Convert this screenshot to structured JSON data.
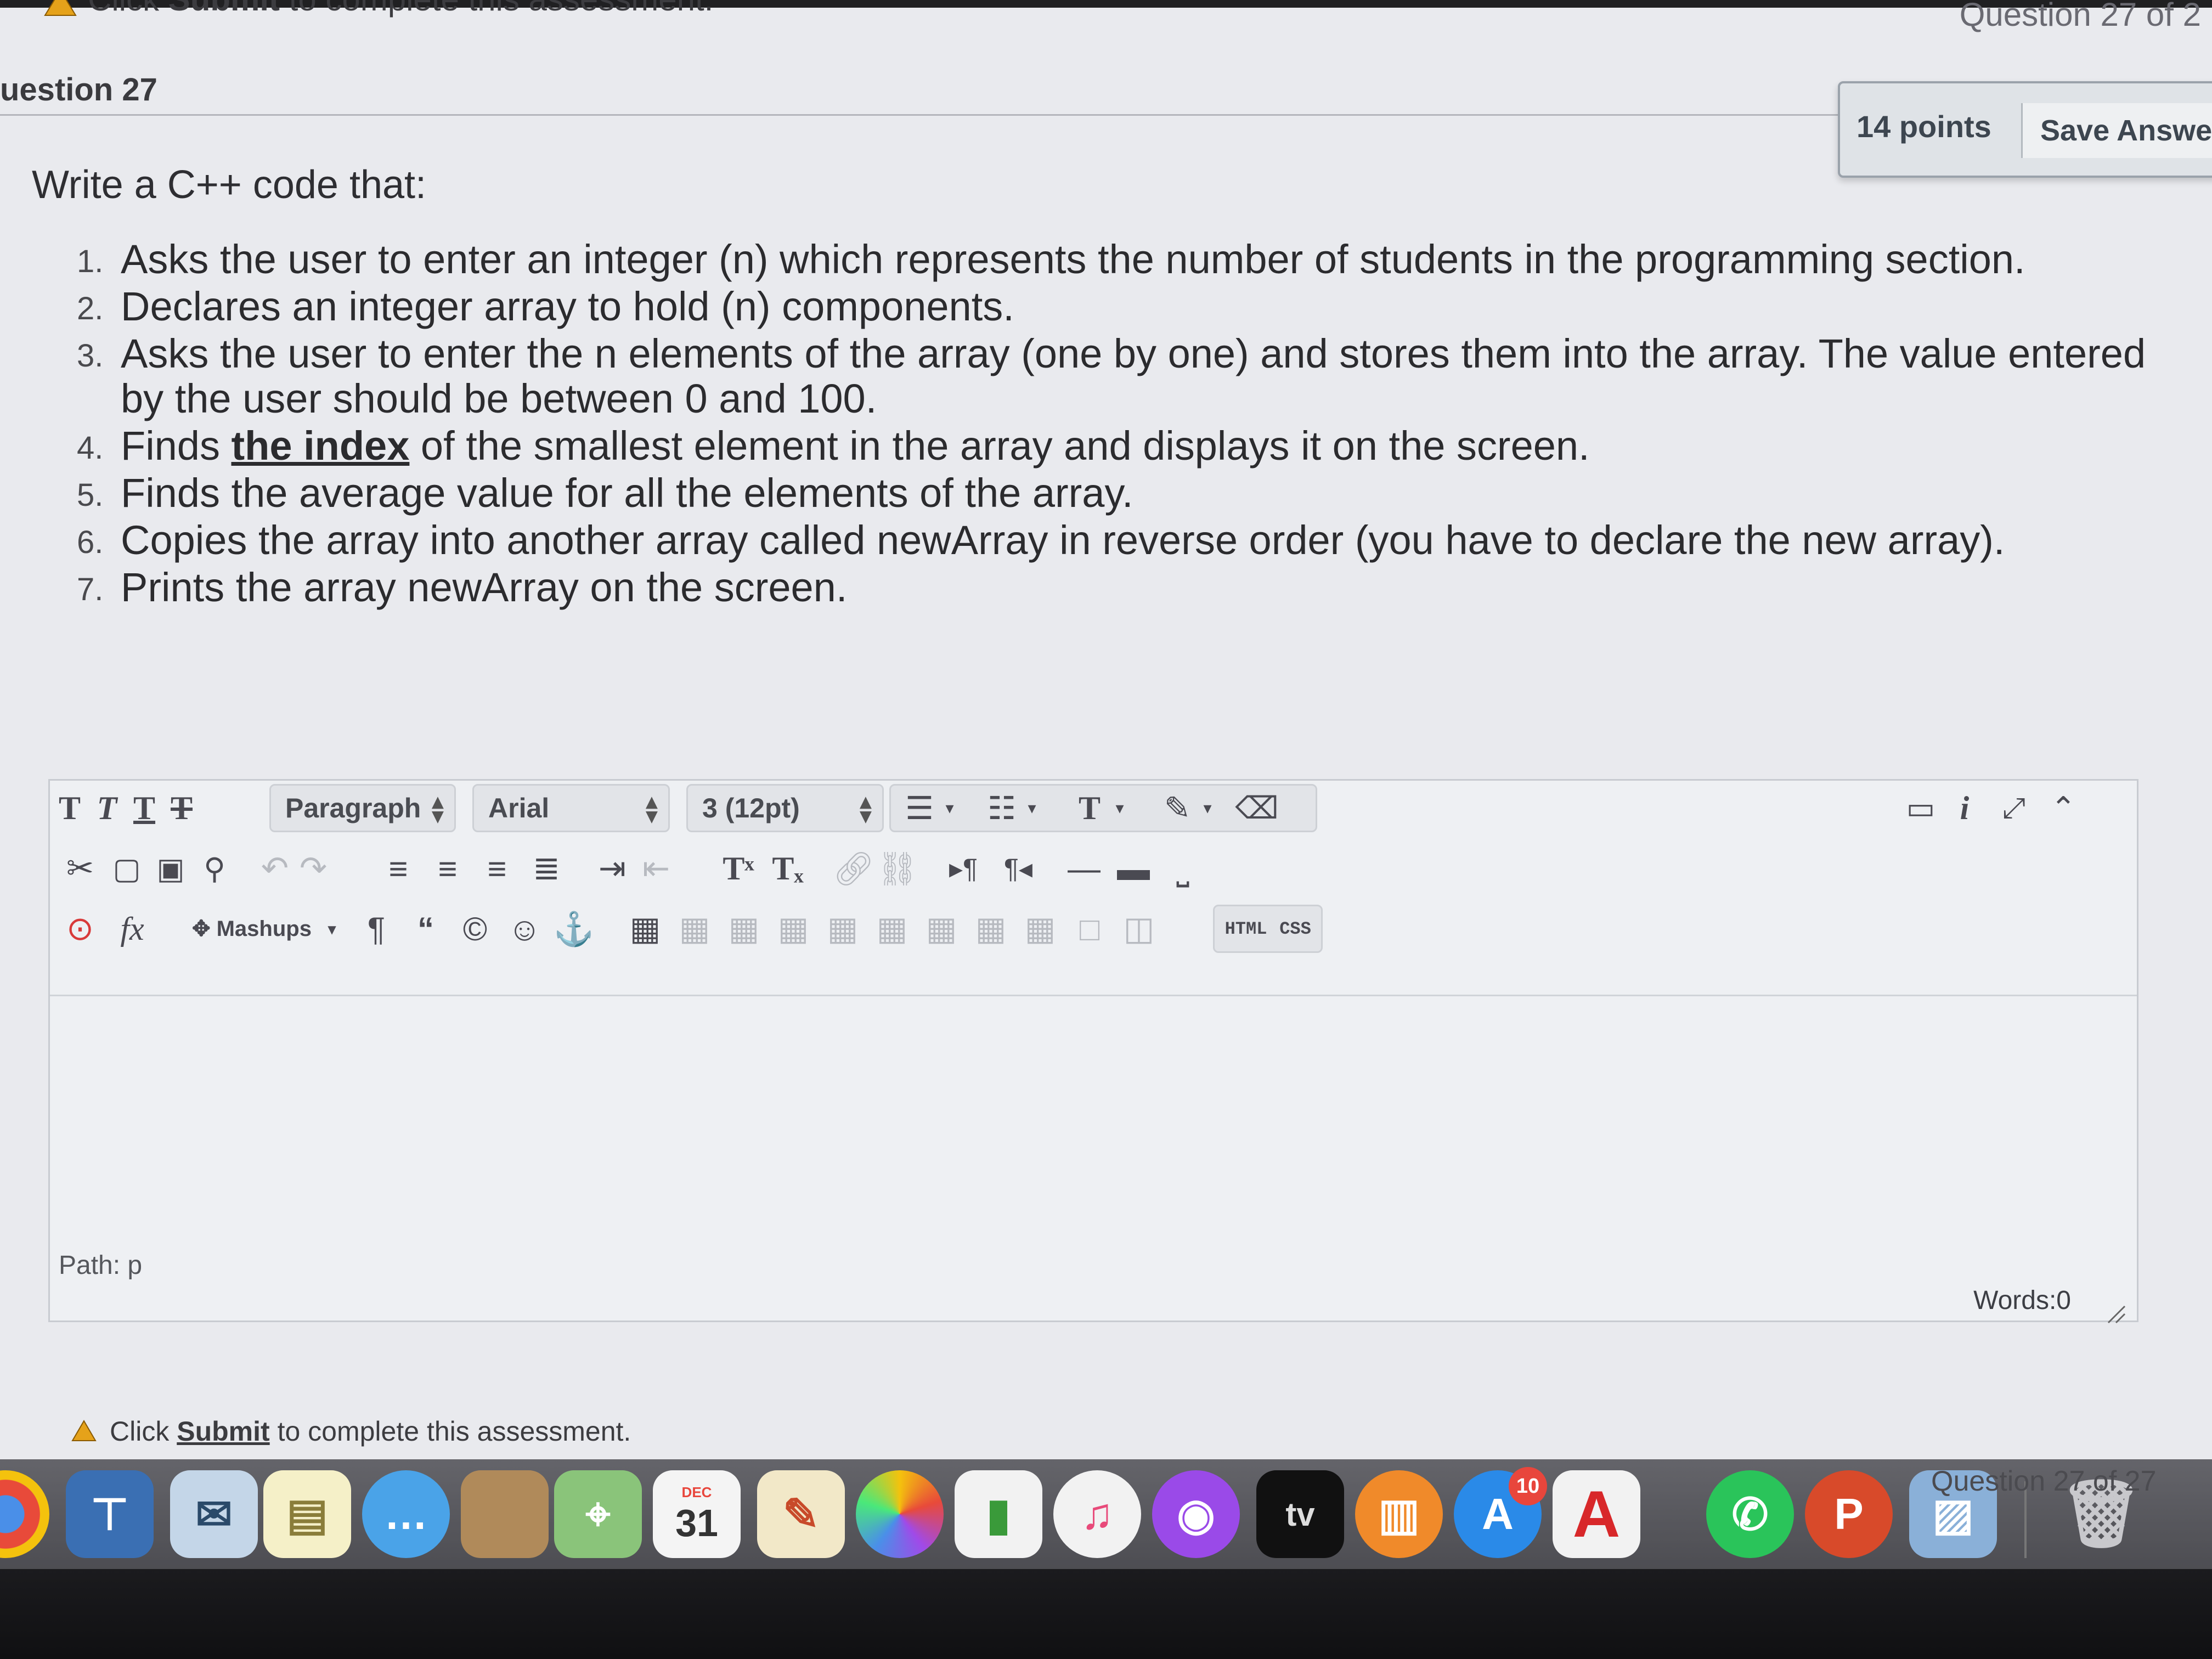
{
  "header": {
    "notice_prefix": "Click",
    "notice_bold": "Submit",
    "notice_suffix": "to complete this assessment.",
    "question_counter": "Question 27 of 2"
  },
  "question": {
    "title": "uestion 27",
    "points": "14 points",
    "save_label": "Save Answer",
    "prompt": "Write a C++ code that:",
    "items": [
      {
        "num": "1.",
        "text": "Asks the user to enter an integer (n) which represents the number of students in the programming section."
      },
      {
        "num": "2.",
        "text": "Declares an integer array to hold (n) components."
      },
      {
        "num": "3.",
        "text": "Asks the user to enter the n elements of the array (one by one) and stores them into the array. The value entered by the user should be between 0 and 100."
      },
      {
        "num": "4.",
        "pre": "Finds",
        "em": "the index",
        "post": "of the smallest element in the array and displays it on the screen."
      },
      {
        "num": "5.",
        "text": "Finds the average value for all the elements of the array."
      },
      {
        "num": "6.",
        "text": "Copies the array into another array called newArray in reverse order (you have to declare the new array)."
      },
      {
        "num": "7.",
        "text": "Prints the array newArray on the screen."
      }
    ]
  },
  "editor": {
    "format_select": "Paragraph",
    "font_select": "Arial",
    "size_select": "3 (12pt)",
    "mashups_label": "Mashups",
    "html_label": "HTML",
    "css_label": "CSS",
    "path_label": "Path: p",
    "words_label": "Words:0"
  },
  "footer": {
    "notice_prefix": "Click",
    "notice_bold": "Submit",
    "notice_suffix": "to complete this assessment.",
    "question_counter": "Question 27 of 27"
  },
  "dock": {
    "calendar_month": "DEC",
    "calendar_day": "31",
    "tv_label": "tv",
    "appstore_badge": "10",
    "powerpoint_letter": "P",
    "acrobat_letter": "A"
  },
  "colors": {
    "page_bg": "#e9eaee",
    "editor_bg": "#eef0f3",
    "dock_bg": "#1b1b1e",
    "badge": "#e8463c"
  }
}
